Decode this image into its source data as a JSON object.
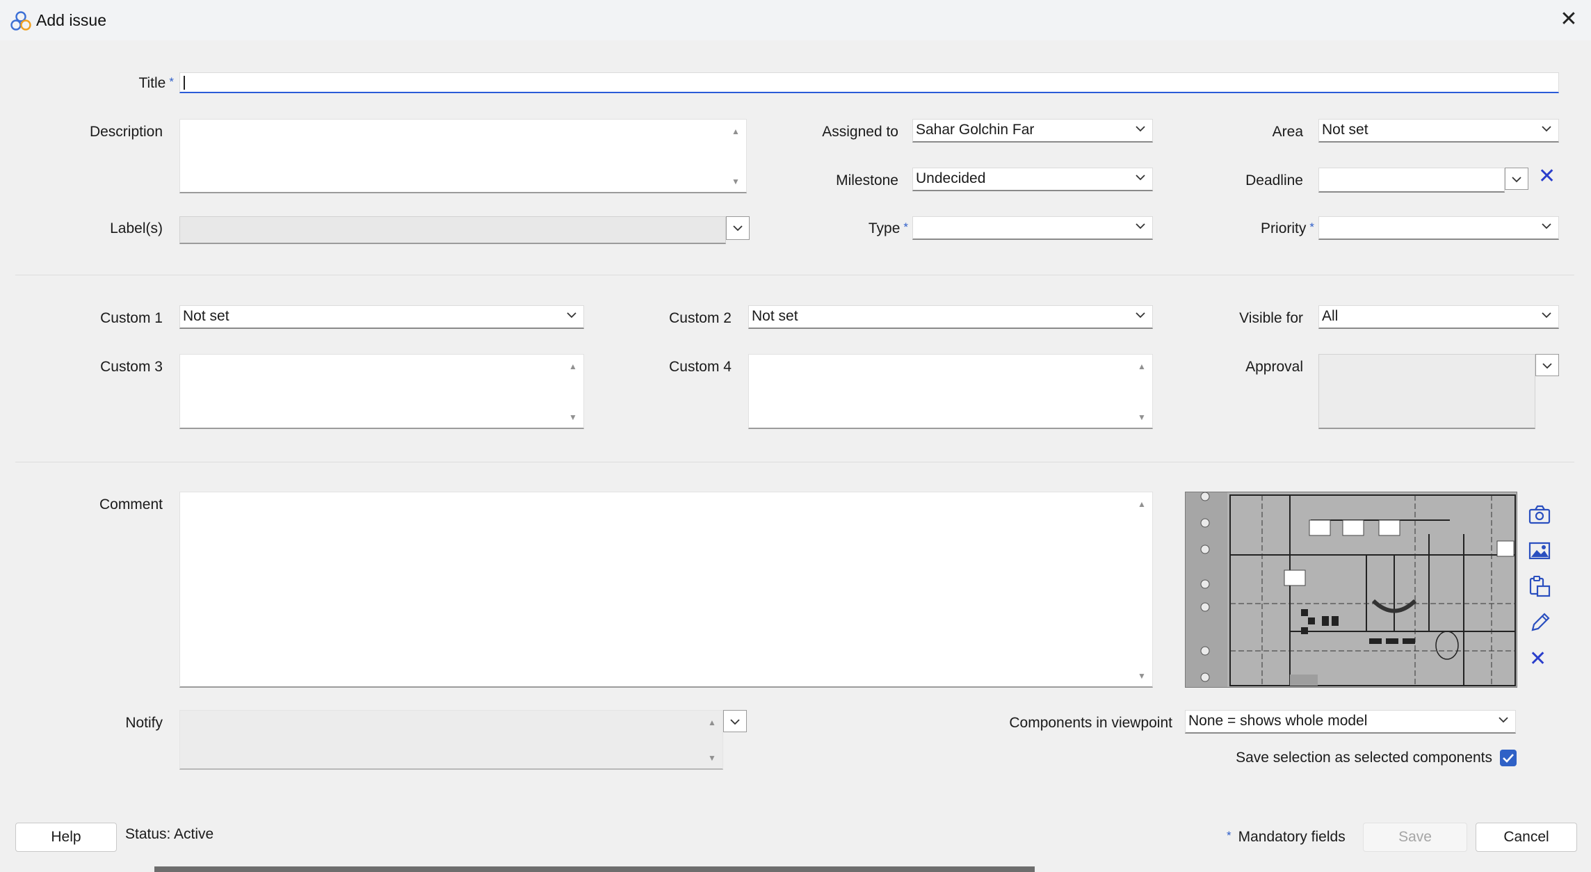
{
  "window": {
    "title": "Add issue"
  },
  "fields": {
    "title_label": "Title",
    "title_value": "",
    "description_label": "Description",
    "description_value": "",
    "labels_label": "Label(s)",
    "assigned_label": "Assigned to",
    "assigned_value": "Sahar Golchin Far",
    "milestone_label": "Milestone",
    "milestone_value": "Undecided",
    "type_label": "Type",
    "type_value": "",
    "area_label": "Area",
    "area_value": "Not set",
    "deadline_label": "Deadline",
    "deadline_value": "",
    "priority_label": "Priority",
    "priority_value": "",
    "custom1_label": "Custom 1",
    "custom1_value": "Not set",
    "custom2_label": "Custom 2",
    "custom2_value": "Not set",
    "visible_label": "Visible for",
    "visible_value": "All",
    "custom3_label": "Custom 3",
    "custom4_label": "Custom 4",
    "approval_label": "Approval",
    "comment_label": "Comment",
    "notify_label": "Notify",
    "components_label": "Components in viewpoint",
    "components_value": "None = shows whole model",
    "save_selection_label": "Save selection as selected components",
    "save_selection_checked": true
  },
  "mandatory_star": "*",
  "footer": {
    "help": "Help",
    "status": "Status: Active",
    "mandatory_note": "Mandatory fields",
    "save": "Save",
    "cancel": "Cancel"
  },
  "icons": {
    "app": "app-logo-icon",
    "close": "close-icon",
    "camera": "camera-icon",
    "image": "image-icon",
    "paste": "paste-icon",
    "pencil": "pencil-icon",
    "delete": "delete-x-icon",
    "checkbox": "checkmark-icon"
  },
  "colors": {
    "accent": "#2f61c6",
    "x_blue": "#2a3ecb",
    "background": "#f0f0f0"
  }
}
